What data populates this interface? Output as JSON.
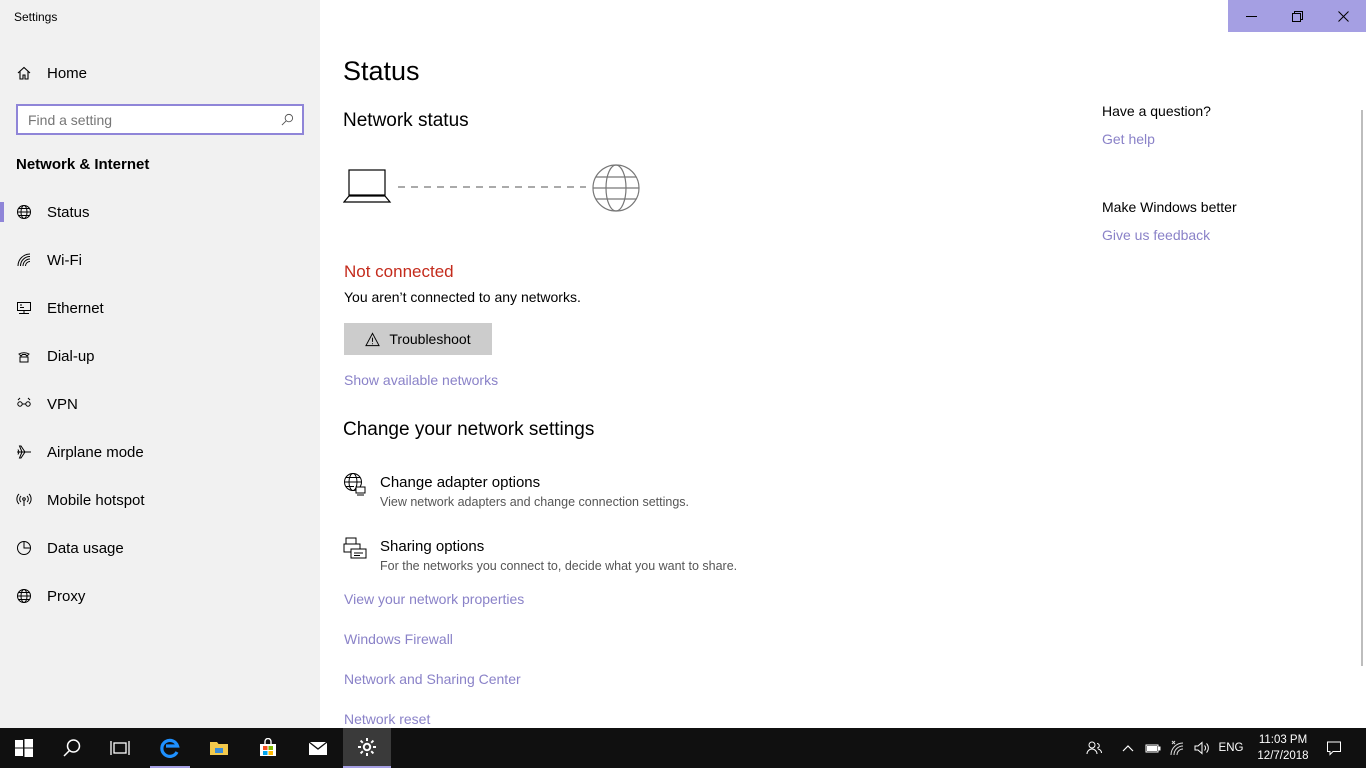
{
  "app": {
    "title": "Settings"
  },
  "sidebar": {
    "home_label": "Home",
    "search_placeholder": "Find a setting",
    "section_title": "Network & Internet",
    "items": [
      {
        "label": "Status",
        "icon": "globe-icon",
        "active": true
      },
      {
        "label": "Wi-Fi",
        "icon": "wifi-icon"
      },
      {
        "label": "Ethernet",
        "icon": "ethernet-icon"
      },
      {
        "label": "Dial-up",
        "icon": "dialup-icon"
      },
      {
        "label": "VPN",
        "icon": "vpn-icon"
      },
      {
        "label": "Airplane mode",
        "icon": "airplane-icon"
      },
      {
        "label": "Mobile hotspot",
        "icon": "hotspot-icon"
      },
      {
        "label": "Data usage",
        "icon": "data-usage-icon"
      },
      {
        "label": "Proxy",
        "icon": "globe-icon"
      }
    ]
  },
  "main": {
    "title": "Status",
    "network_status_heading": "Network status",
    "status_text": "Not connected",
    "status_desc": "You aren’t connected to any networks.",
    "troubleshoot_label": "Troubleshoot",
    "show_networks_link": "Show available networks",
    "change_heading": "Change your network settings",
    "settings": [
      {
        "title": "Change adapter options",
        "subtitle": "View network adapters and change connection settings.",
        "icon": "adapter-icon"
      },
      {
        "title": "Sharing options",
        "subtitle": "For the networks you connect to, decide what you want to share.",
        "icon": "sharing-icon"
      }
    ],
    "links": [
      "View your network properties",
      "Windows Firewall",
      "Network and Sharing Center",
      "Network reset"
    ]
  },
  "aside": {
    "question_heading": "Have a question?",
    "get_help": "Get help",
    "feedback_heading": "Make Windows better",
    "give_feedback": "Give us feedback"
  },
  "taskbar": {
    "language": "ENG",
    "time": "11:03 PM",
    "date": "12/7/2018"
  },
  "colors": {
    "accent": "#a59fe3",
    "error": "#c42b1c",
    "link": "#8a82c8"
  }
}
